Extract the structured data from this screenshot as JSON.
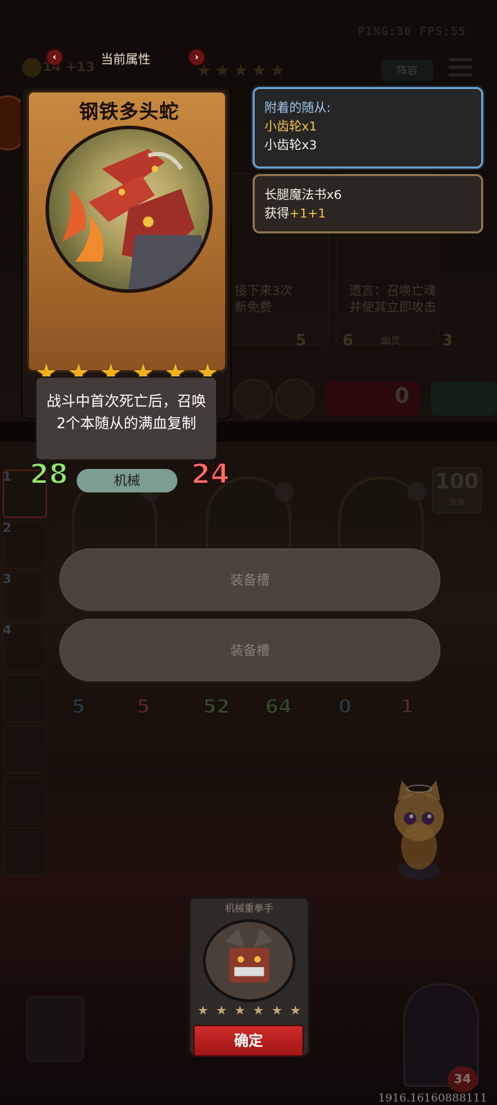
{
  "hud": {
    "ping_fps": "PING:36   FPS:55",
    "gold": "14 +13",
    "team_button": "阵容",
    "background_stars": "★★★★★"
  },
  "attribute_panel": {
    "title": "当前属性",
    "prev_arrow": "‹",
    "next_arrow": "›"
  },
  "card": {
    "name": "钢铁多头蛇",
    "stars": [
      "★",
      "★",
      "★",
      "★",
      "★",
      "★"
    ],
    "description": "战斗中首次死亡后，召唤2个本随从的满血复制",
    "attack": "28",
    "health": "24",
    "tribe": "机械"
  },
  "tooltips": {
    "attached_heading": "附着的随从:",
    "attached_items": [
      {
        "name": "小齿轮",
        "qty": "x1",
        "highlight": true
      },
      {
        "name": "小齿轮",
        "qty": "x3",
        "highlight": false
      }
    ],
    "buff_source": "长腿魔法书x6",
    "buff_gain_prefix": "获得",
    "buff_gain_value": "+1+1"
  },
  "background_shop": {
    "card1_text": "接下来3次\n新免费",
    "card1_cost": "5",
    "card2_text": "遗言：召唤亡魂\n并使其立即攻击",
    "card2_atk": "6",
    "card2_hp": "3",
    "card2_tribe": "幽灵",
    "refresh_cost": "0"
  },
  "board": {
    "counter_value": "100",
    "counter_label": "准备",
    "roster_numbers": [
      "1",
      "2",
      "3",
      "4"
    ],
    "stats": [
      {
        "atk": "5",
        "hp": "5"
      },
      {
        "atk": "52",
        "hp": "64"
      },
      {
        "atk": "0",
        "hp": "1"
      }
    ]
  },
  "equipment_slots": [
    "装备槽",
    "装备槽"
  ],
  "picked_card": {
    "name": "机械重拳手",
    "stars": [
      "★",
      "★",
      "★",
      "★",
      "★",
      "★"
    ],
    "confirm_label": "确定"
  },
  "hero": {
    "health": "34"
  },
  "footer_id": "1916.16160888111",
  "colors": {
    "star_gold": "#f1b21f",
    "attack_green": "#9be36e",
    "health_red": "#ff6f6a",
    "tooltip_blue_border": "#6b9fcb",
    "highlight_yellow": "#f0c449",
    "confirm_red": "#c62222"
  }
}
